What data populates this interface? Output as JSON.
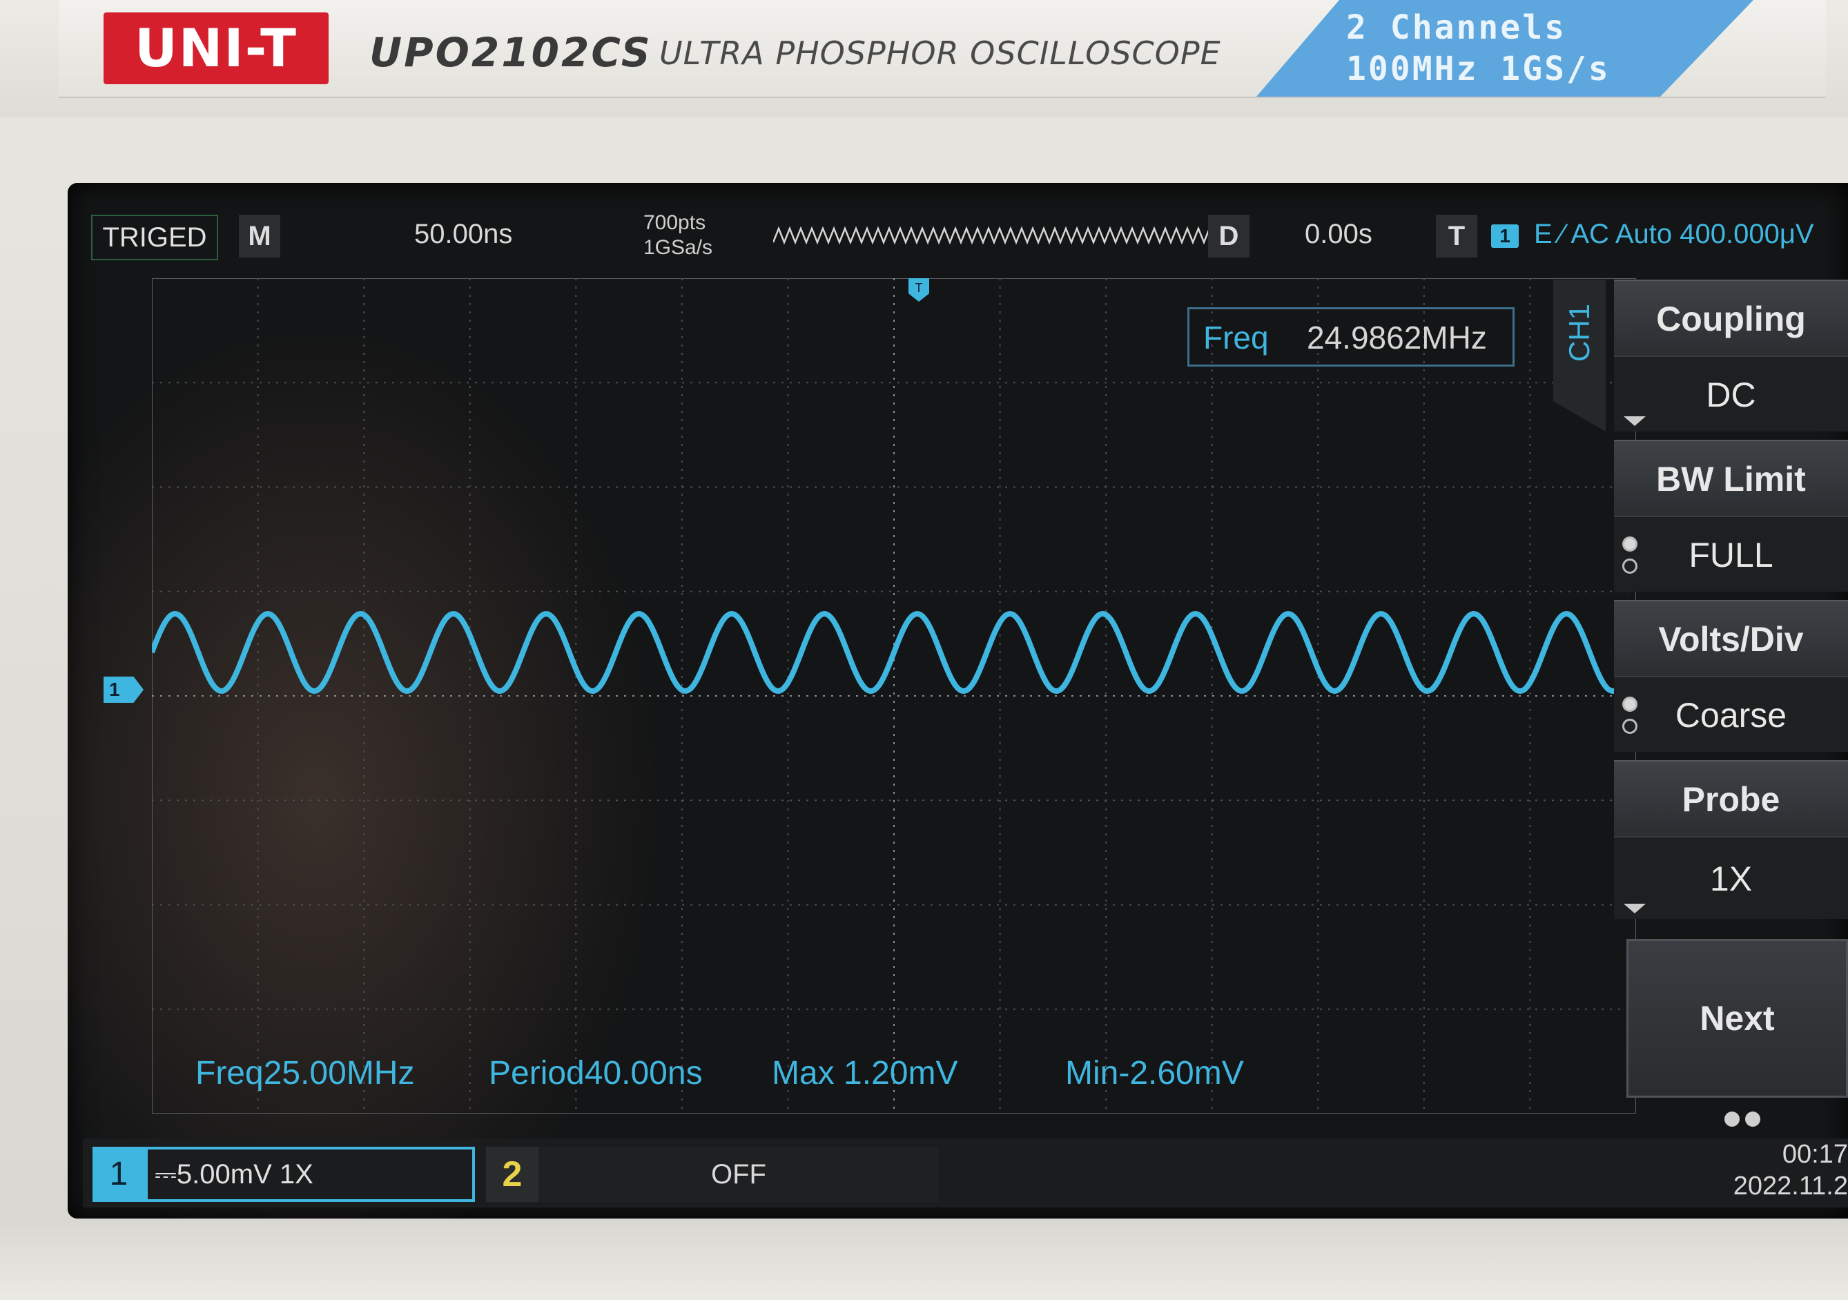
{
  "device": {
    "brand_logo": "UNI-T",
    "model": "UPO2102CS",
    "subtitle": "ULTRA PHOSPHOR OSCILLOSCOPE",
    "spec_line1": "2 Channels",
    "spec_line2": "100MHz 1GS/s",
    "brand_color": "#d61f2c",
    "badge_color": "#5ea6de"
  },
  "status_bar": {
    "trigger_state": "TRIGED",
    "mode_tag": "M",
    "timebase": "50.00ns",
    "memory_depth": "700pts",
    "sample_rate": "1GSa/s",
    "delay_tag": "D",
    "delay": "0.00s",
    "trigger_tag": "T",
    "trigger_channel": "1",
    "trigger_info": "E ⁄ AC Auto 400.000μV"
  },
  "screen": {
    "trigger_marker": "T",
    "channel_marker": "1",
    "trace_color": "#3fb6e0",
    "waveform_cycles_visible": 16,
    "freq_readout": {
      "label": "Freq",
      "value": "24.9862MHz"
    }
  },
  "measurements": [
    {
      "label": "Freq",
      "value": "25.00MHz"
    },
    {
      "label": "Period",
      "value": "40.00ns"
    },
    {
      "label": "Max",
      "value": "1.20mV"
    },
    {
      "label": "Min",
      "value": "-2.60mV"
    }
  ],
  "menu": {
    "channel_tab": "CH1",
    "items": [
      {
        "label": "Coupling",
        "value": "DC"
      },
      {
        "label": "BW  Limit",
        "value": "FULL"
      },
      {
        "label": "Volts/Div",
        "value": "Coarse"
      },
      {
        "label": "Probe",
        "value": "1X"
      }
    ],
    "next_label": "Next"
  },
  "bottom_bar": {
    "ch1_number": "1",
    "ch1_setting": "⎓5.00mV 1X",
    "ch2_number": "2",
    "ch2_setting": "OFF",
    "time": "00:17",
    "date": "2022.11.2"
  }
}
